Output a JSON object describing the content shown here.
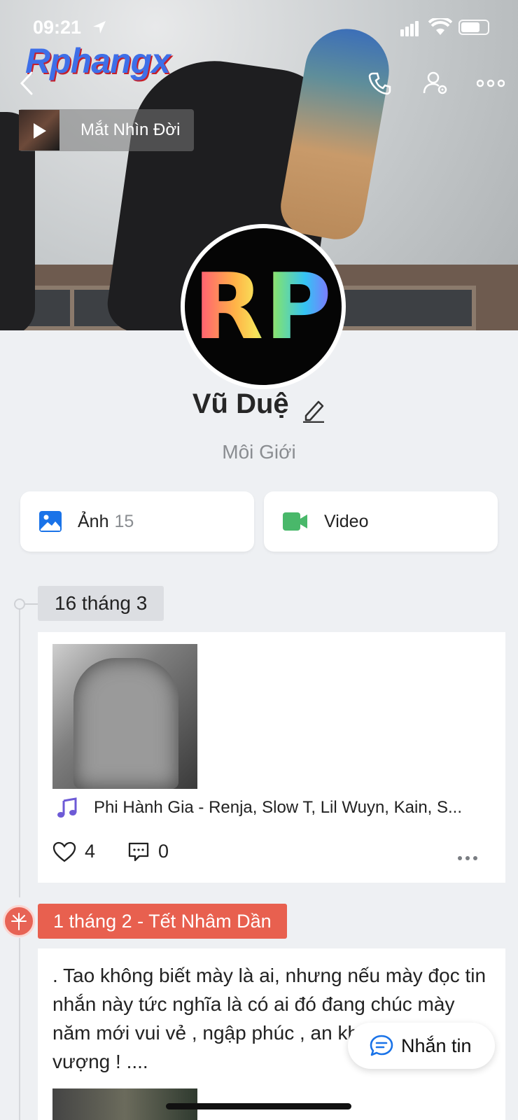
{
  "status_bar": {
    "time": "09:21"
  },
  "watermark": "Rphangx",
  "cover_music": {
    "title": "Mắt Nhìn Đời"
  },
  "avatar_text": "RP",
  "profile": {
    "name": "Vũ Duệ",
    "subtitle": "Môi Giới"
  },
  "media": {
    "photos_label": "Ảnh",
    "photos_count": "15",
    "video_label": "Video"
  },
  "timeline": [
    {
      "date": "16 tháng 3",
      "music": "Phi Hành Gia - Renja, Slow T, Lil Wuyn, Kain, S...",
      "likes": "4",
      "comments": "0"
    },
    {
      "date": "1 tháng 2 - Tết Nhâm Dần",
      "text": ". Tao không biết mày là ai, nhưng nếu mày đọc tin nhắn này tức nghĩa là có ai đó đang chúc mày năm mới vui vẻ , ngập phúc , an khang thịnh vượng ! ...."
    }
  ],
  "message_button": "Nhắn tin",
  "colors": {
    "accent_red": "#e8604f",
    "brand_blue": "#1a73e8",
    "video_green": "#49b86a"
  }
}
